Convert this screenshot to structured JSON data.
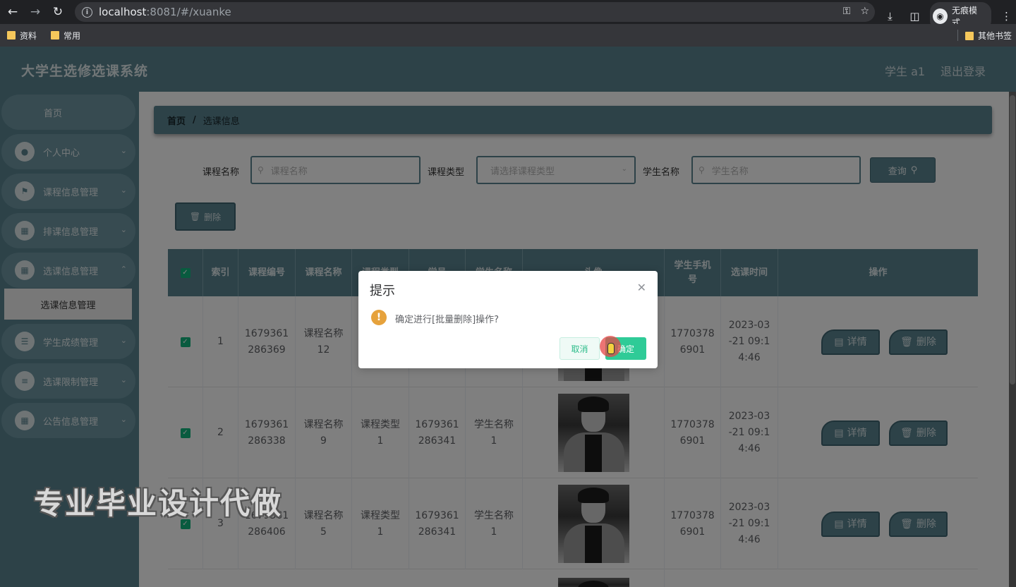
{
  "browser": {
    "url_host": "localhost",
    "url_rest": ":8081/#/xuanke",
    "incognito_label": "无痕模式",
    "bookmarks": [
      "资料",
      "常用"
    ],
    "other_bookmarks": "其他书签"
  },
  "header": {
    "title": "大学生选修选课系统",
    "user": "学生 a1",
    "logout": "退出登录"
  },
  "sidebar": {
    "home": "首页",
    "items": [
      {
        "label": "个人中心",
        "icon": "user-icon"
      },
      {
        "label": "课程信息管理",
        "icon": "flag-icon"
      },
      {
        "label": "排课信息管理",
        "icon": "grid-icon"
      },
      {
        "label": "选课信息管理",
        "icon": "grid-icon"
      },
      {
        "label": "学生成绩管理",
        "icon": "list-icon"
      },
      {
        "label": "选课限制管理",
        "icon": "sliders-icon"
      },
      {
        "label": "公告信息管理",
        "icon": "grid-icon"
      }
    ],
    "sub_item": "选课信息管理"
  },
  "breadcrumb": {
    "home": "首页",
    "sep": "/",
    "current": "选课信息"
  },
  "filters": {
    "course_name_label": "课程名称",
    "course_name_placeholder": "课程名称",
    "course_type_label": "课程类型",
    "course_type_placeholder": "请选择课程类型",
    "student_name_label": "学生名称",
    "student_name_placeholder": "学生名称",
    "query_button": "查询"
  },
  "actions": {
    "delete_button": "删除"
  },
  "table": {
    "headers": [
      "索引",
      "课程编号",
      "课程名称",
      "课程类型",
      "学号",
      "学生名称",
      "头像",
      "学生手机\n号",
      "选课时间",
      "操作"
    ],
    "rows": [
      {
        "index": "1",
        "course_no": "1679361\n286369",
        "course_name": "课程名称\n12",
        "course_type": "",
        "student_no": "",
        "student_name": "",
        "phone": "1770378\n6901",
        "time": "2023-03\n-21 09:1\n4:46"
      },
      {
        "index": "2",
        "course_no": "1679361\n286338",
        "course_name": "课程名称\n9",
        "course_type": "课程类型\n1",
        "student_no": "1679361\n286341",
        "student_name": "学生名称\n1",
        "phone": "1770378\n6901",
        "time": "2023-03\n-21 09:1\n4:46"
      },
      {
        "index": "3",
        "course_no": "1679361\n286406",
        "course_name": "课程名称\n5",
        "course_type": "课程类型\n1",
        "student_no": "1679361\n286341",
        "student_name": "学生名称\n1",
        "phone": "1770378\n6901",
        "time": "2023-03\n-21 09:1\n4:46"
      }
    ],
    "detail_label": "详情",
    "delete_label": "删除"
  },
  "dialog": {
    "title": "提示",
    "message": "确定进行[批量删除]操作?",
    "cancel": "取消",
    "confirm": "确定"
  },
  "watermark": "专业毕业设计代做",
  "colors": {
    "primary": "#5a8491",
    "confirm": "#2fcb97",
    "warning": "#e6a23c",
    "check": "#13b67f"
  }
}
